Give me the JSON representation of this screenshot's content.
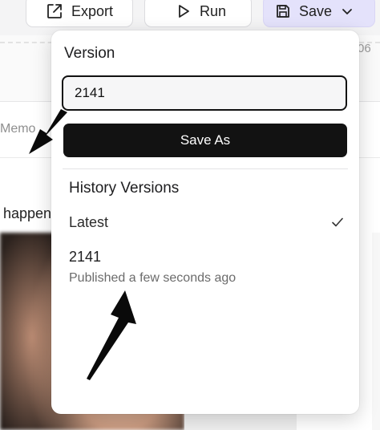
{
  "toolbar": {
    "export_label": "Export",
    "run_label": "Run",
    "save_label": "Save"
  },
  "background": {
    "number_fragment": "06",
    "memo_fragment": "Memo",
    "text_fragment": "happen"
  },
  "popover": {
    "title": "Version",
    "version_input_value": "2141",
    "save_as_label": "Save As",
    "history_title": "History Versions",
    "items": [
      {
        "label": "Latest",
        "selected": true
      },
      {
        "label": "2141",
        "subtitle": "Published a few seconds ago"
      }
    ]
  },
  "colors": {
    "save_button_bg": "#e4e2fb",
    "primary_dark": "#121212"
  },
  "icons": [
    "export-icon",
    "play-icon",
    "save-disk-icon",
    "chevron-down-icon",
    "checkmark-icon"
  ]
}
